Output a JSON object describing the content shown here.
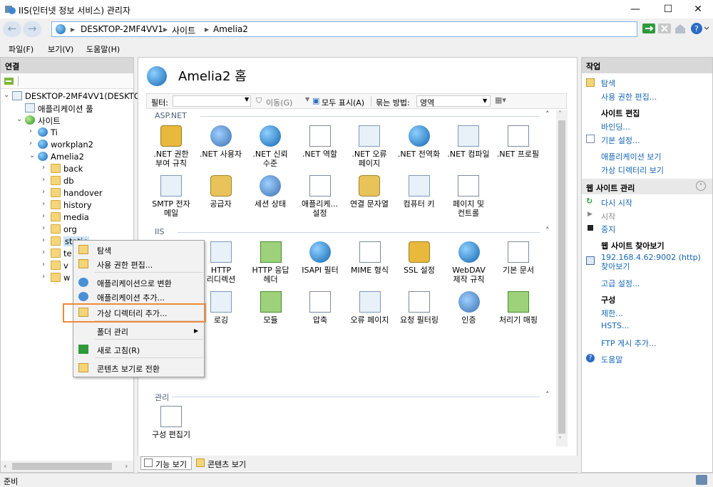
{
  "window": {
    "title": "IIS(인터넷 정보 서비스) 관리자",
    "minimize": "—",
    "maximize": "☐",
    "close": "✕"
  },
  "address": {
    "back": "←",
    "forward": "→",
    "crumbs": [
      "DESKTOP-2MF4VV1",
      "사이트",
      "Amelia2"
    ],
    "sep": "▶"
  },
  "menu": [
    "파일(F)",
    "보기(V)",
    "도움말(H)"
  ],
  "connections": {
    "header": "연결",
    "tree": [
      {
        "label": "DESKTOP-2MF4VV1(DESKTO",
        "exp": "⌄",
        "icon": "server"
      },
      {
        "label": "애플리케이션 풀",
        "exp": "",
        "icon": "pool"
      },
      {
        "label": "사이트",
        "exp": "⌄",
        "icon": "sites"
      },
      {
        "label": "Ti",
        "exp": "›",
        "icon": "globe"
      },
      {
        "label": "workplan2",
        "exp": "›",
        "icon": "globe"
      },
      {
        "label": "Amelia2",
        "exp": "⌄",
        "icon": "globe"
      },
      {
        "label": "back",
        "exp": "›",
        "icon": "folder"
      },
      {
        "label": "db",
        "exp": "›",
        "icon": "folder"
      },
      {
        "label": "handover",
        "exp": "›",
        "icon": "folder"
      },
      {
        "label": "history",
        "exp": "›",
        "icon": "folder"
      },
      {
        "label": "media",
        "exp": "›",
        "icon": "folder"
      },
      {
        "label": "org",
        "exp": "›",
        "icon": "folder"
      },
      {
        "label": "static",
        "exp": "›",
        "icon": "folder"
      },
      {
        "label": "te",
        "exp": "›",
        "icon": "folder"
      },
      {
        "label": "v",
        "exp": "›",
        "icon": "folder"
      },
      {
        "label": "w",
        "exp": "›",
        "icon": "folder"
      }
    ]
  },
  "center": {
    "title": "Amelia2 홈",
    "filter_label": "필터:",
    "go_label": "이동(G)",
    "show_all_label": "모두 표시(A)",
    "group_label": "묶는 방법:",
    "group_value": "영역",
    "sections": {
      "aspnet": "ASP.NET",
      "iis": "IIS",
      "manage": "관리"
    },
    "aspnet_features": [
      ".NET 권한\n부여 규칙",
      ".NET 사용자",
      ".NET 신뢰\n수준",
      ".NET 역할",
      ".NET 오류\n페이지",
      ".NET 전역화",
      ".NET 컴파일",
      ".NET 프로필",
      "SMTP 전자\n메일",
      "공급자",
      "세션 상태",
      "애플리케...\n설정",
      "연결 문자열",
      "컴퓨터 키",
      "페이지 및\n컨트롤"
    ],
    "iis_features": [
      "HTTP\n리디렉션",
      "HTTP 응답\n헤더",
      "ISAPI 필터",
      "MIME 형식",
      "SSL 설정",
      "WebDAV\n제작 규칙",
      "기본 문서",
      "로깅",
      "모듈",
      "압축",
      "오류 페이지",
      "요청 필터링",
      "인증",
      "처리기 매핑"
    ],
    "manage_features": [
      "구성 편집기"
    ],
    "tabs": [
      "기능 보기",
      "콘텐츠 보기"
    ]
  },
  "actions": {
    "header": "작업",
    "explore": "탐색",
    "edit_permissions": "사용 권한 편집...",
    "site_edit_hdr": "사이트 편집",
    "bindings": "바인딩...",
    "basic_settings": "기본 설정...",
    "view_apps": "애플리케이션 보기",
    "view_vdirs": "가상 디렉터리 보기",
    "manage_site_hdr": "웹 사이트 관리",
    "restart": "다시 시작",
    "start": "시작",
    "stop": "중지",
    "browse_hdr": "웹 사이트 찾아보기",
    "browse_link": "192.168.4.62:9002 (http) 찾아보기",
    "advanced": "고급 설정...",
    "config_hdr": "구성",
    "limits": "제한...",
    "hsts": "HSTS...",
    "ftp": "FTP 게시 추가...",
    "help": "도움말"
  },
  "context_menu": {
    "items": [
      "탐색",
      "사용 권한 편집...",
      "애플리케이션으로 변환",
      "애플리케이션 추가...",
      "가상 디렉터리 추가...",
      "폴더 관리",
      "새로 고침(R)",
      "콘텐츠 보기로 전환"
    ],
    "submenu_arrow": "▶"
  },
  "status": {
    "text": "준비"
  },
  "colors": {
    "accent": "#1566b5",
    "highlight": "#ec8a3a"
  }
}
